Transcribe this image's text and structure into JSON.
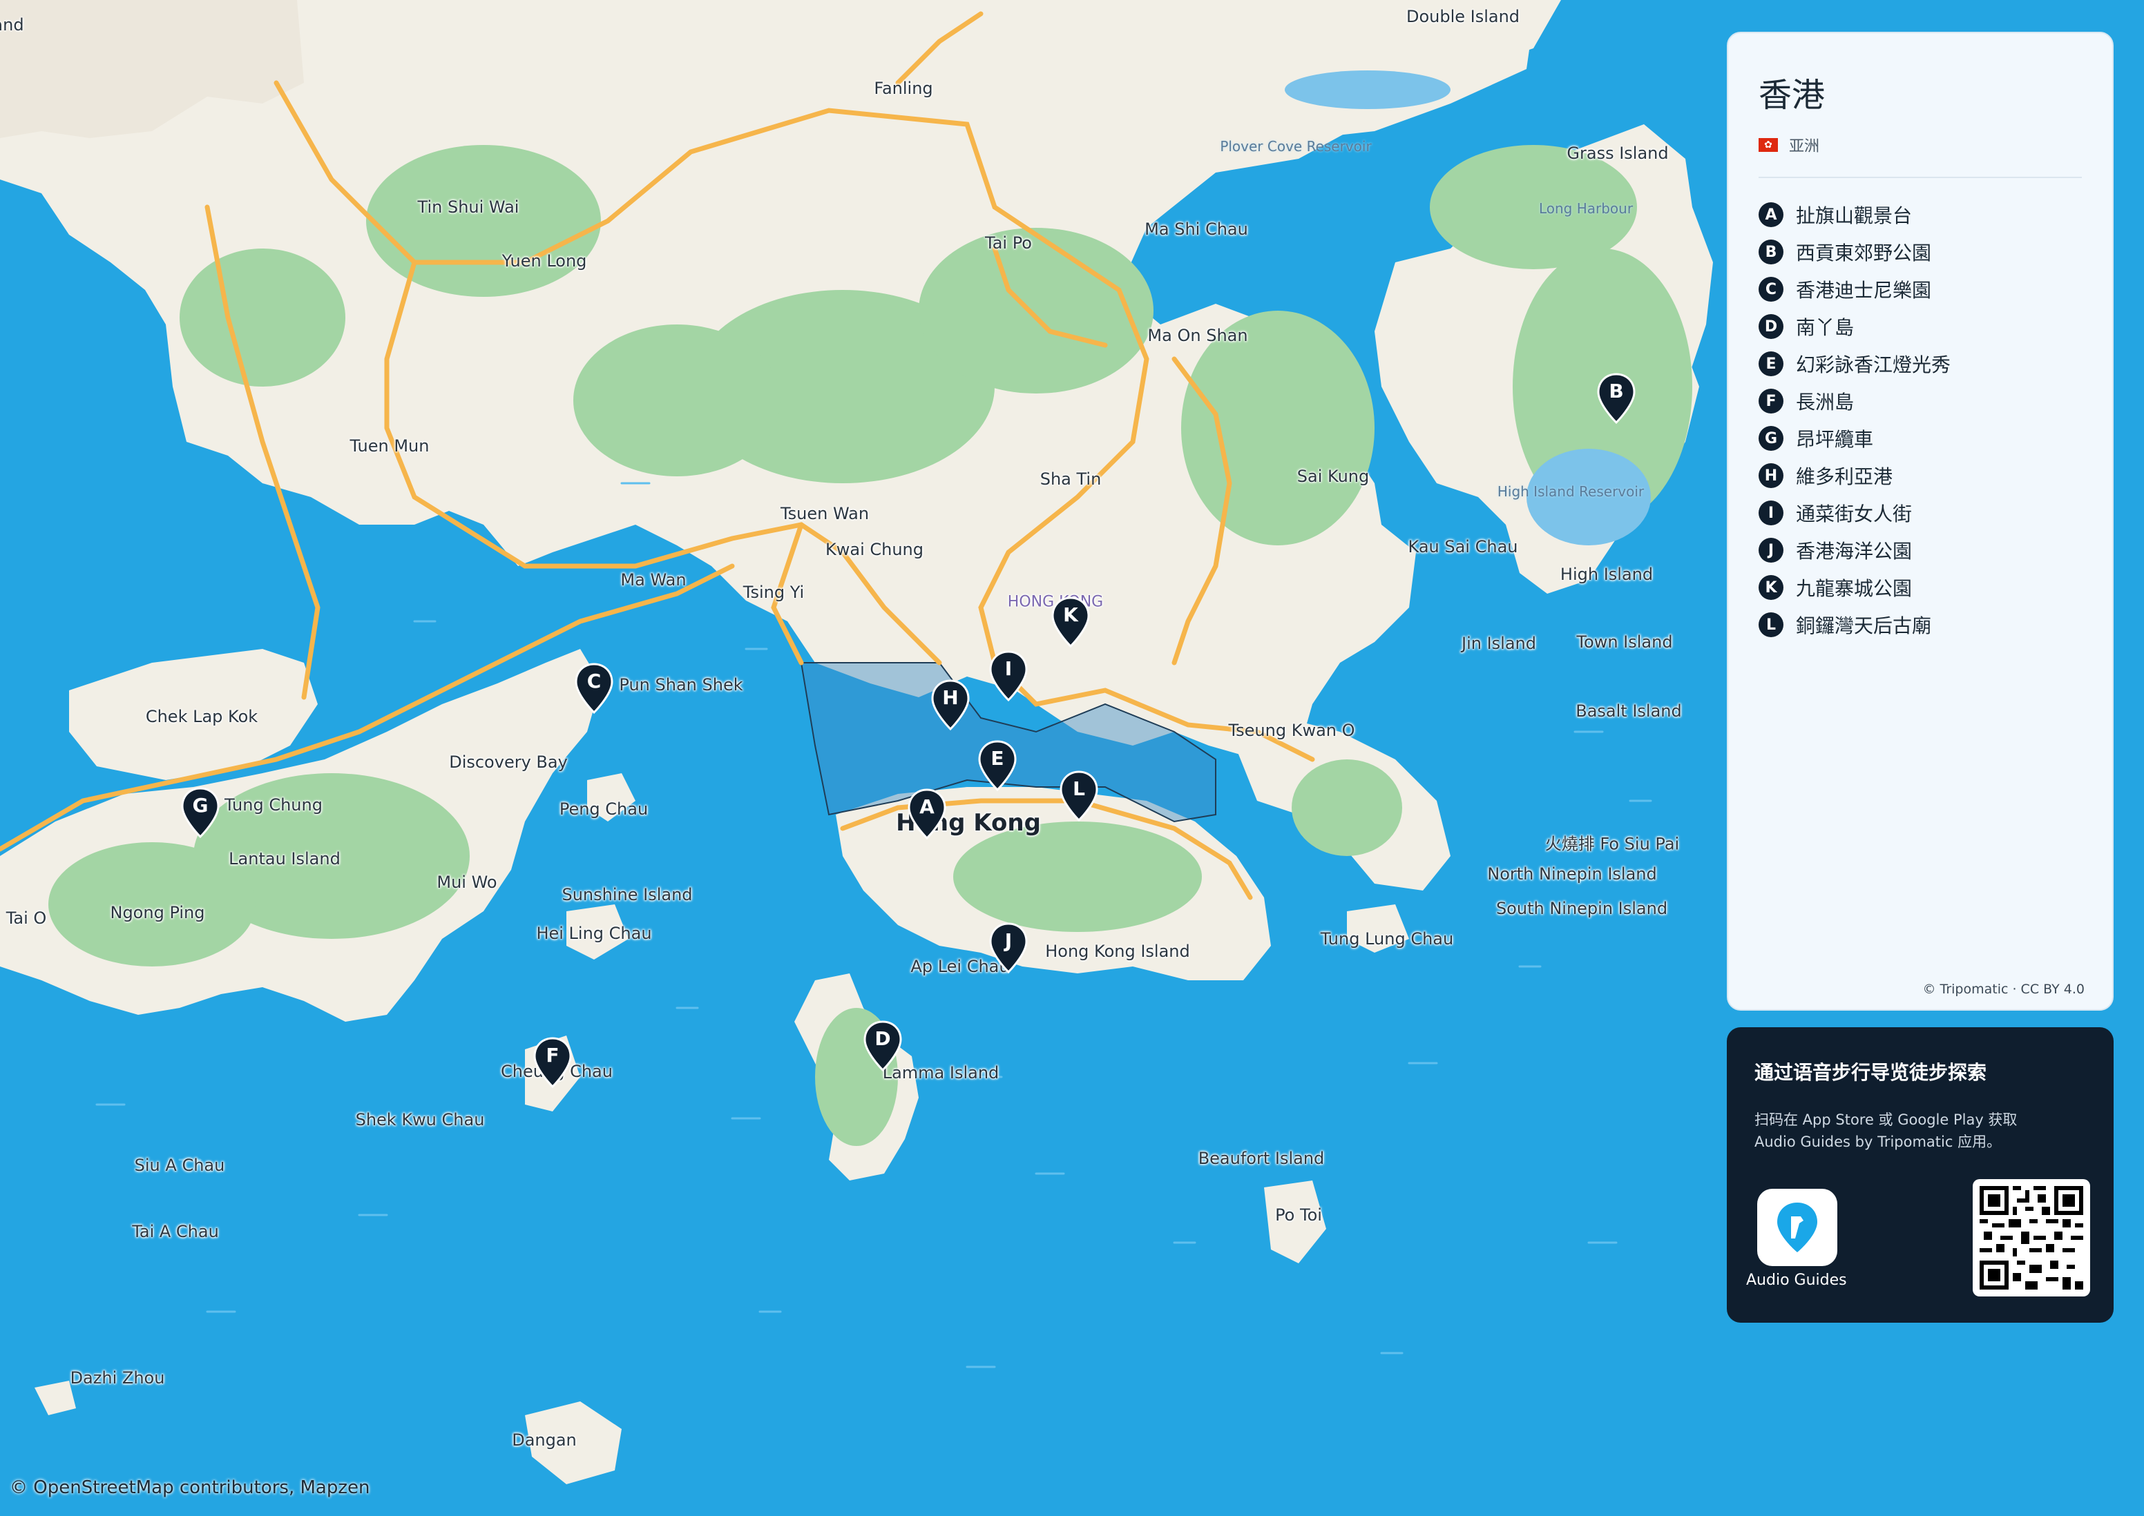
{
  "map": {
    "colors": {
      "water": "#24a5e2",
      "land": "#f2efe6",
      "green": "#9fd0a2",
      "road": "#f6b54b",
      "marker": "#0f1e2e"
    },
    "place_labels": [
      {
        "id": "double-island",
        "text": "Double Island",
        "kind": "place"
      },
      {
        "id": "fanling",
        "text": "Fanling",
        "kind": "place"
      },
      {
        "id": "grass-island",
        "text": "Grass Island",
        "kind": "place"
      },
      {
        "id": "plover-cove",
        "text": "Plover Cove Reservoir",
        "kind": "water"
      },
      {
        "id": "tin-shui-wai",
        "text": "Tin Shui Wai",
        "kind": "place"
      },
      {
        "id": "long-harbour",
        "text": "Long Harbour",
        "kind": "water"
      },
      {
        "id": "ma-shi-chau",
        "text": "Ma Shi Chau",
        "kind": "place"
      },
      {
        "id": "tai-po",
        "text": "Tai Po",
        "kind": "place"
      },
      {
        "id": "yuen-long",
        "text": "Yuen Long",
        "kind": "place"
      },
      {
        "id": "ma-on-shan",
        "text": "Ma On Shan",
        "kind": "place"
      },
      {
        "id": "tuen-mun",
        "text": "Tuen Mun",
        "kind": "place"
      },
      {
        "id": "sha-tin",
        "text": "Sha Tin",
        "kind": "place"
      },
      {
        "id": "sai-kung",
        "text": "Sai Kung",
        "kind": "place"
      },
      {
        "id": "high-island-reservoir",
        "text": "High Island Reservoir",
        "kind": "water"
      },
      {
        "id": "tsuen-wan",
        "text": "Tsuen Wan",
        "kind": "place"
      },
      {
        "id": "kwai-chung",
        "text": "Kwai Chung",
        "kind": "place"
      },
      {
        "id": "kau-sai-chau",
        "text": "Kau Sai Chau",
        "kind": "place"
      },
      {
        "id": "high-island",
        "text": "High Island",
        "kind": "place"
      },
      {
        "id": "ma-wan",
        "text": "Ma Wan",
        "kind": "place"
      },
      {
        "id": "tsing-yi",
        "text": "Tsing Yi",
        "kind": "place"
      },
      {
        "id": "hongkong-district",
        "text": "HONG KONG",
        "kind": "district"
      },
      {
        "id": "jin-island",
        "text": "Jin Island",
        "kind": "place"
      },
      {
        "id": "town-island",
        "text": "Town Island",
        "kind": "place"
      },
      {
        "id": "pun-shan-shek",
        "text": "Pun Shan Shek",
        "kind": "place"
      },
      {
        "id": "chek-lap-kok",
        "text": "Chek Lap Kok",
        "kind": "place"
      },
      {
        "id": "basalt-island",
        "text": "Basalt Island",
        "kind": "place"
      },
      {
        "id": "tseung-kwan-o",
        "text": "Tseung Kwan O",
        "kind": "place"
      },
      {
        "id": "discovery-bay",
        "text": "Discovery Bay",
        "kind": "place"
      },
      {
        "id": "tung-chung",
        "text": "Tung Chung",
        "kind": "place"
      },
      {
        "id": "peng-chau",
        "text": "Peng Chau",
        "kind": "place"
      },
      {
        "id": "hong-kong",
        "text": "Hong Kong",
        "kind": "big"
      },
      {
        "id": "fo-siu-pai",
        "text": "火燒排 Fo Siu Pai",
        "kind": "place"
      },
      {
        "id": "lantau-island",
        "text": "Lantau Island",
        "kind": "place"
      },
      {
        "id": "north-ninepin",
        "text": "North Ninepin Island",
        "kind": "place"
      },
      {
        "id": "mui-wo",
        "text": "Mui Wo",
        "kind": "place"
      },
      {
        "id": "sunshine-island",
        "text": "Sunshine Island",
        "kind": "place"
      },
      {
        "id": "south-ninepin",
        "text": "South Ninepin Island",
        "kind": "place"
      },
      {
        "id": "tai-o",
        "text": "Tai O",
        "kind": "place"
      },
      {
        "id": "ngong-ping",
        "text": "Ngong Ping",
        "kind": "place"
      },
      {
        "id": "hei-ling-chau",
        "text": "Hei Ling Chau",
        "kind": "place"
      },
      {
        "id": "tung-lung-chau",
        "text": "Tung Lung Chau",
        "kind": "place"
      },
      {
        "id": "hong-kong-island",
        "text": "Hong Kong Island",
        "kind": "place"
      },
      {
        "id": "ap-lei-chau",
        "text": "Ap Lei Chau",
        "kind": "place"
      },
      {
        "id": "cheung-chau",
        "text": "Cheung Chau",
        "kind": "place"
      },
      {
        "id": "lamma-island",
        "text": "Lamma Island",
        "kind": "place"
      },
      {
        "id": "shek-kwu-chau",
        "text": "Shek Kwu Chau",
        "kind": "place"
      },
      {
        "id": "beaufort-island",
        "text": "Beaufort Island",
        "kind": "place"
      },
      {
        "id": "siu-a-chau",
        "text": "Siu A Chau",
        "kind": "place"
      },
      {
        "id": "po-toi",
        "text": "Po Toi",
        "kind": "place"
      },
      {
        "id": "tai-a-chau",
        "text": "Tai A Chau",
        "kind": "place"
      },
      {
        "id": "dazhi-zhou",
        "text": "Dazhi Zhou",
        "kind": "place"
      },
      {
        "id": "dangan",
        "text": "Dangan",
        "kind": "place"
      },
      {
        "id": "edge-label",
        "text": "and",
        "kind": "place"
      }
    ],
    "markers": [
      {
        "letter": "A"
      },
      {
        "letter": "B"
      },
      {
        "letter": "C"
      },
      {
        "letter": "D"
      },
      {
        "letter": "E"
      },
      {
        "letter": "F"
      },
      {
        "letter": "G"
      },
      {
        "letter": "H"
      },
      {
        "letter": "I"
      },
      {
        "letter": "J"
      },
      {
        "letter": "K"
      },
      {
        "letter": "L"
      }
    ],
    "attribution": "© OpenStreetMap contributors, Mapzen"
  },
  "sidebar": {
    "title": "香港",
    "region": "亚洲",
    "flag_icon": "hong-kong-flag-icon",
    "places": [
      {
        "letter": "A",
        "name": "扯旗山觀景台"
      },
      {
        "letter": "B",
        "name": "西貢東郊野公園"
      },
      {
        "letter": "C",
        "name": "香港迪士尼樂園"
      },
      {
        "letter": "D",
        "name": "南丫島"
      },
      {
        "letter": "E",
        "name": "幻彩詠香江燈光秀"
      },
      {
        "letter": "F",
        "name": "長洲島"
      },
      {
        "letter": "G",
        "name": "昂坪纜車"
      },
      {
        "letter": "H",
        "name": "維多利亞港"
      },
      {
        "letter": "I",
        "name": "通菜街女人街"
      },
      {
        "letter": "J",
        "name": "香港海洋公園"
      },
      {
        "letter": "K",
        "name": "九龍寨城公園"
      },
      {
        "letter": "L",
        "name": "銅鑼灣天后古廟"
      }
    ],
    "credit": "© Tripomatic · CC BY 4.0"
  },
  "promo": {
    "title": "通过语音步行导览徒步探索",
    "text": "扫码在 App Store 或 Google Play 获取\nAudio Guides by Tripomatic 应用。",
    "app_name": "Audio Guides",
    "app_icon": "audio-guides-pin-icon",
    "qr_icon": "qr-code-icon"
  }
}
